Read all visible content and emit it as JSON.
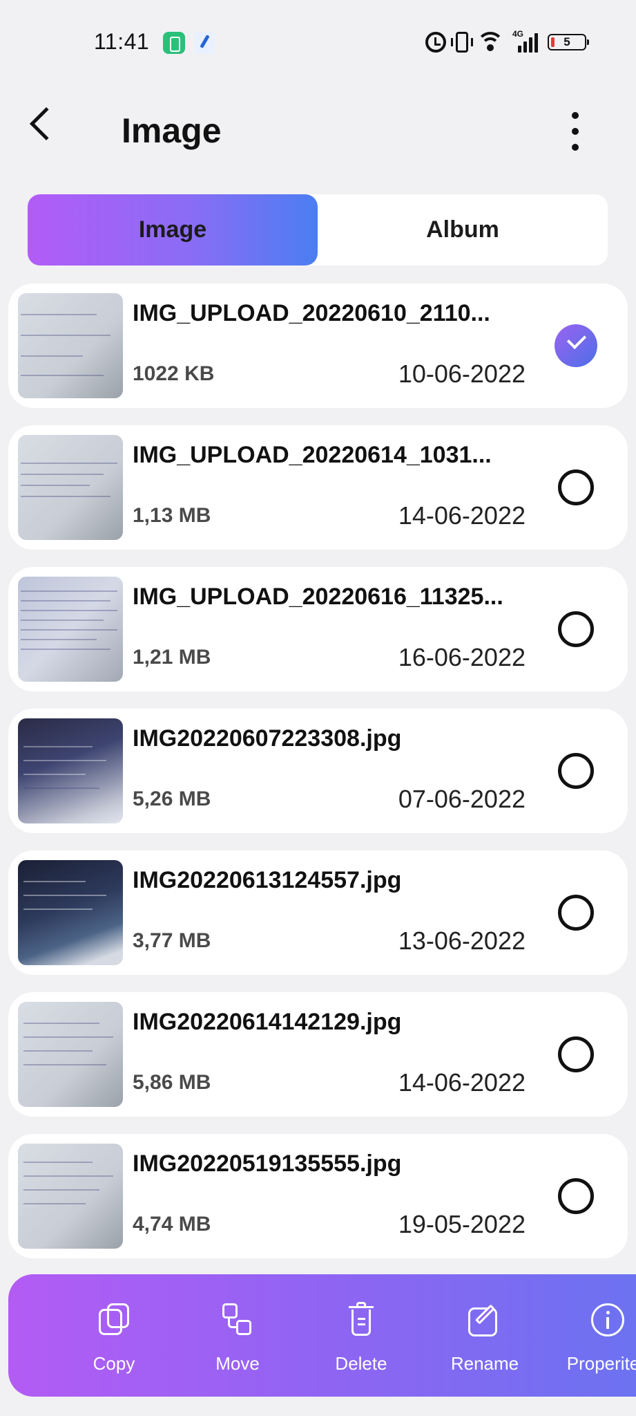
{
  "status_bar": {
    "time": "11:41",
    "network_label": "4G",
    "battery_level": "5"
  },
  "header": {
    "title": "Image"
  },
  "tabs": [
    {
      "label": "Image",
      "active": true
    },
    {
      "label": "Album",
      "active": false
    }
  ],
  "files": [
    {
      "name": "IMG_UPLOAD_20220610_2110...",
      "size": "1022 KB",
      "date": "10-06-2022",
      "selected": true
    },
    {
      "name": "IMG_UPLOAD_20220614_1031...",
      "size": "1,13 MB",
      "date": "14-06-2022",
      "selected": false
    },
    {
      "name": "IMG_UPLOAD_20220616_11325...",
      "size": "1,21 MB",
      "date": "16-06-2022",
      "selected": false
    },
    {
      "name": "IMG20220607223308.jpg",
      "size": "5,26 MB",
      "date": "07-06-2022",
      "selected": false
    },
    {
      "name": "IMG20220613124557.jpg",
      "size": "3,77 MB",
      "date": "13-06-2022",
      "selected": false
    },
    {
      "name": "IMG20220614142129.jpg",
      "size": "5,86 MB",
      "date": "14-06-2022",
      "selected": false
    },
    {
      "name": "IMG20220519135555.jpg",
      "size": "4,74 MB",
      "date": "19-05-2022",
      "selected": false
    }
  ],
  "actions": [
    {
      "label": "Copy",
      "icon": "copy-icon"
    },
    {
      "label": "Move",
      "icon": "move-icon"
    },
    {
      "label": "Delete",
      "icon": "delete-icon"
    },
    {
      "label": "Rename",
      "icon": "rename-icon"
    },
    {
      "label": "Properites",
      "icon": "info-icon"
    }
  ],
  "colors": {
    "accent_gradient_start": "#b25cf6",
    "accent_gradient_end": "#4b7ef2",
    "background": "#f1f1f3"
  }
}
